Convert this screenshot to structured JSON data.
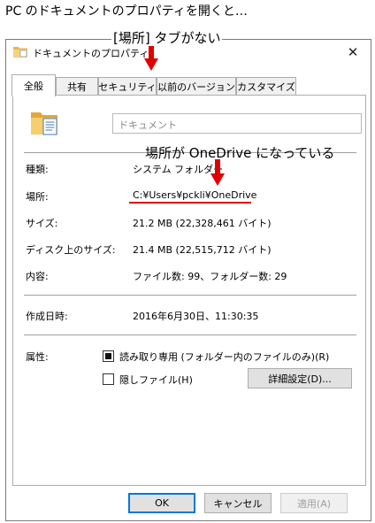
{
  "caption": "PC のドキュメントのプロパティを開くと…",
  "window": {
    "title": "ドキュメントのプロパティ",
    "close_glyph": "✕"
  },
  "tabs": [
    {
      "label": "全般",
      "active": true
    },
    {
      "label": "共有",
      "active": false
    },
    {
      "label": "セキュリティ",
      "active": false
    },
    {
      "label": "以前のバージョン",
      "active": false
    },
    {
      "label": "カスタマイズ",
      "active": false
    }
  ],
  "general": {
    "name_placeholder": "ドキュメント",
    "type_label": "種類:",
    "type_value": "システム フォルダー",
    "location_label": "場所:",
    "location_value": "C:¥Users¥pckli¥OneDrive",
    "size_label": "サイズ:",
    "size_value": "21.2 MB (22,328,461 バイト)",
    "disk_size_label": "ディスク上のサイズ:",
    "disk_size_value": "21.4 MB (22,515,712 バイト)",
    "contents_label": "内容:",
    "contents_value": "ファイル数: 99、フォルダー数: 29",
    "created_label": "作成日時:",
    "created_value": "2016年6月30日、11:30:35",
    "attributes_label": "属性:",
    "readonly_label": "読み取り専用 (フォルダー内のファイルのみ)(R)",
    "readonly_checked": true,
    "hidden_label": "隠しファイル(H)",
    "hidden_checked": false,
    "advanced_button": "詳細設定(D)..."
  },
  "buttons": {
    "ok": "OK",
    "cancel": "キャンセル",
    "apply": "適用(A)"
  },
  "annotations": {
    "no_location_tab": "[場所] タブがない",
    "onedrive_note": "場所が OneDrive になっている",
    "accent_color": "#e00000"
  }
}
